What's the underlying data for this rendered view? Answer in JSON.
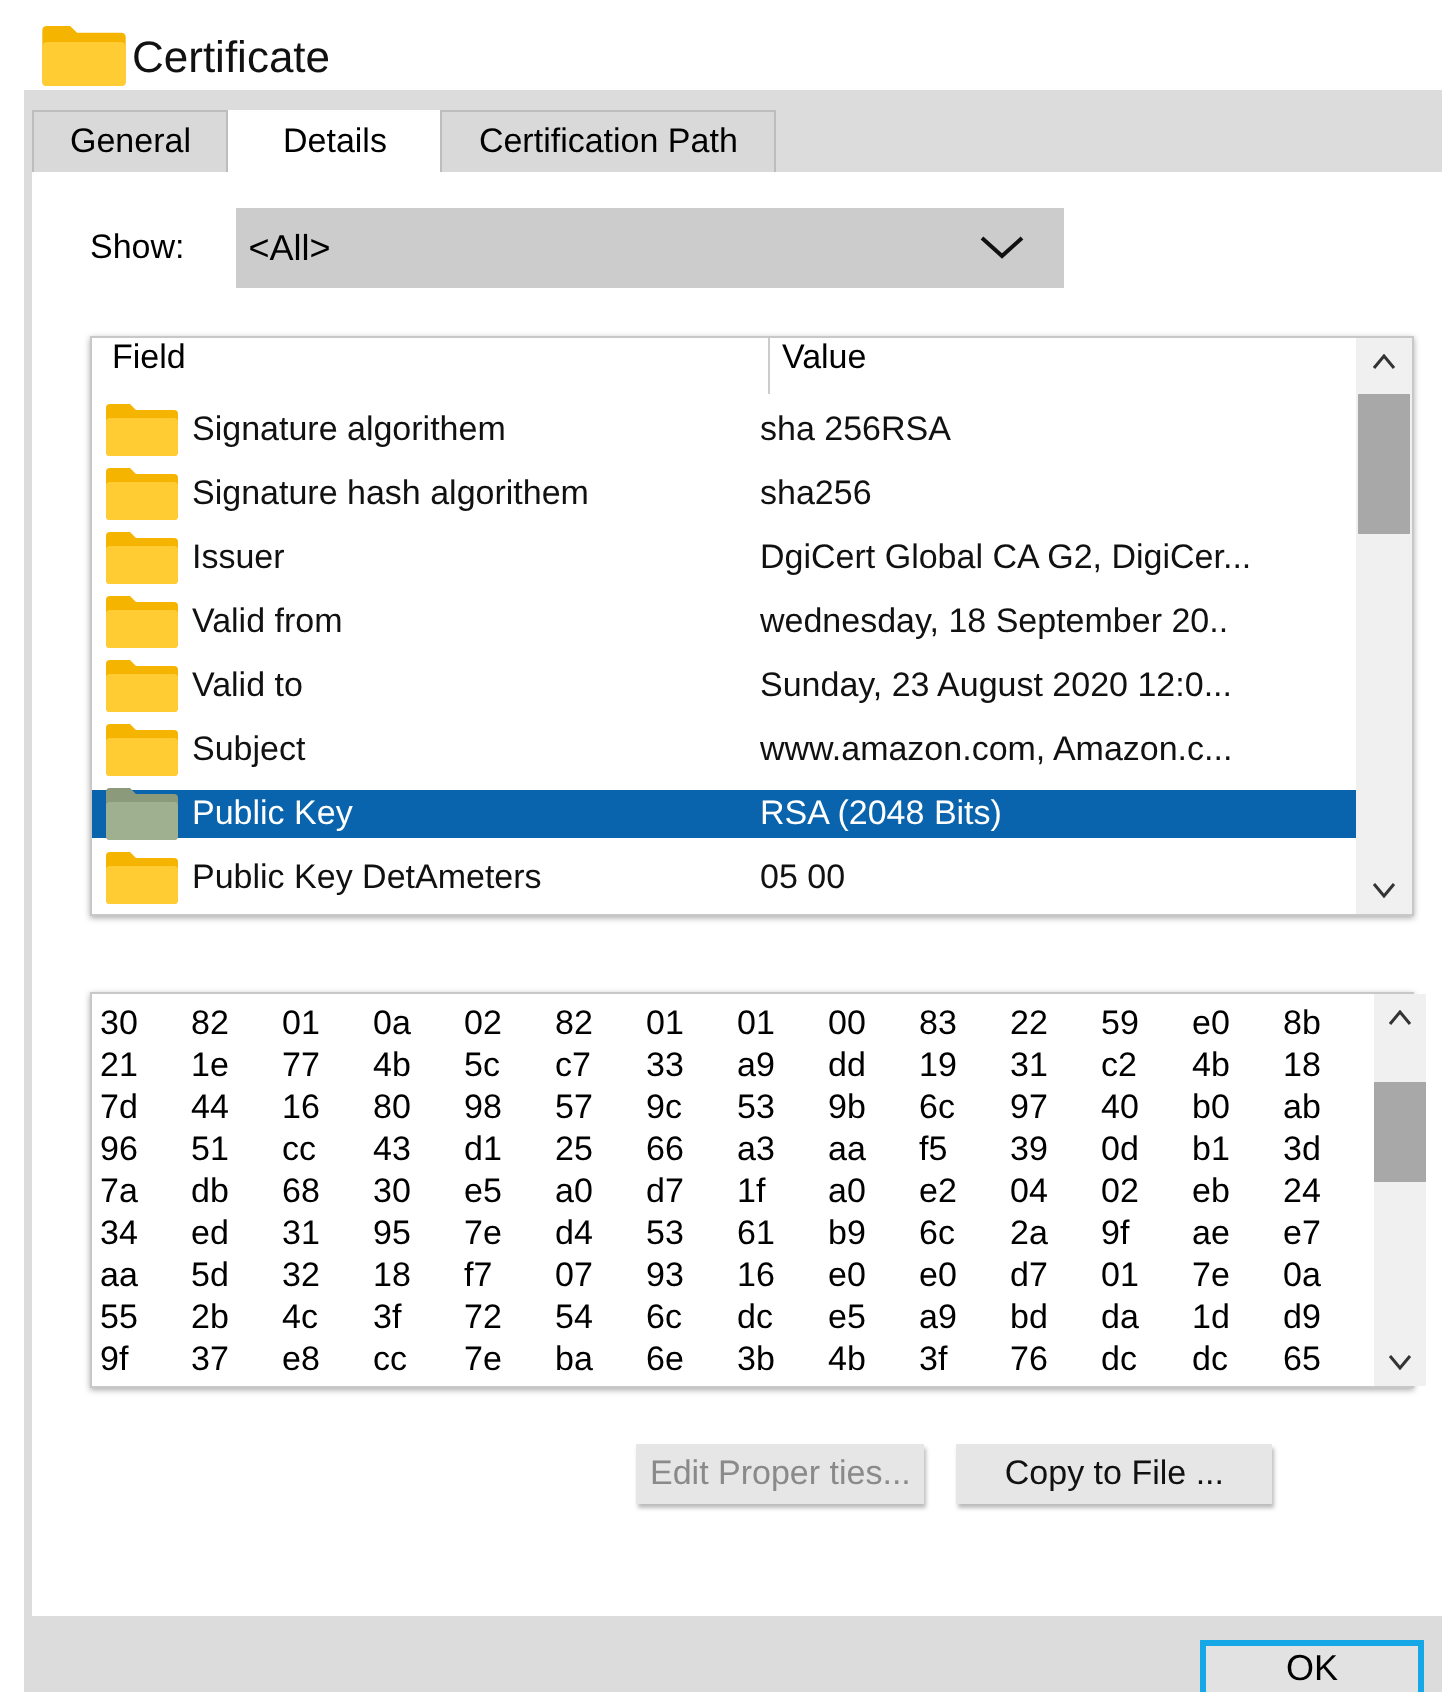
{
  "window": {
    "title": "Certificate"
  },
  "tabs": [
    {
      "label": "General",
      "selected": false
    },
    {
      "label": "Details",
      "selected": true
    },
    {
      "label": "Certification Path",
      "selected": false
    }
  ],
  "show": {
    "label": "Show:",
    "value": "<All>"
  },
  "fields": {
    "columns": [
      "Field",
      "Value"
    ],
    "rows": [
      {
        "field": "Signature algorithem",
        "value": "sha 256RSA",
        "selected": false
      },
      {
        "field": "Signature hash algorithem",
        "value": "sha256",
        "selected": false
      },
      {
        "field": "Issuer",
        "value": "DgiCert Global CA G2, DigiCer...",
        "selected": false
      },
      {
        "field": "Valid from",
        "value": "wednesday, 18 September 20..",
        "selected": false
      },
      {
        "field": "Valid to",
        "value": "Sunday, 23 August 2020 12:0...",
        "selected": false
      },
      {
        "field": "Subject",
        "value": "www.amazon.com, Amazon.c...",
        "selected": false
      },
      {
        "field": "Public Key",
        "value": "RSA (2048 Bits)",
        "selected": true
      },
      {
        "field": "Public Key DetAmeters",
        "value": "05 00",
        "selected": false
      }
    ]
  },
  "hex": [
    [
      "30",
      "82",
      "01",
      "0a",
      "02",
      "82",
      "01",
      "01",
      "00",
      "83",
      "22",
      "59",
      "e0",
      "8b"
    ],
    [
      "21",
      "1e",
      "77",
      "4b",
      "5c",
      "c7",
      "33",
      "a9",
      "dd",
      "19",
      "31",
      "c2",
      "4b",
      "18"
    ],
    [
      "7d",
      "44",
      "16",
      "80",
      "98",
      "57",
      "9c",
      "53",
      "9b",
      "6c",
      "97",
      "40",
      "b0",
      "ab"
    ],
    [
      "96",
      "51",
      "cc",
      "43",
      "d1",
      "25",
      "66",
      "a3",
      "aa",
      "f5",
      "39",
      "0d",
      "b1",
      "3d"
    ],
    [
      "7a",
      "db",
      "68",
      "30",
      "e5",
      "a0",
      "d7",
      "1f",
      "a0",
      "e2",
      "04",
      "02",
      "eb",
      "24"
    ],
    [
      "34",
      "ed",
      "31",
      "95",
      "7e",
      "d4",
      "53",
      "61",
      "b9",
      "6c",
      "2a",
      "9f",
      "ae",
      "e7"
    ],
    [
      "aa",
      "5d",
      "32",
      "18",
      "f7",
      "07",
      "93",
      "16",
      "e0",
      "e0",
      "d7",
      "01",
      "7e",
      "0a"
    ],
    [
      "55",
      "2b",
      "4c",
      "3f",
      "72",
      "54",
      "6c",
      "dc",
      "e5",
      "a9",
      "bd",
      "da",
      "1d",
      "d9"
    ],
    [
      "9f",
      "37",
      "e8",
      "cc",
      "7e",
      "ba",
      "6e",
      "3b",
      "4b",
      "3f",
      "76",
      "dc",
      "dc",
      "65"
    ]
  ],
  "buttons": [
    {
      "label": "Edit Proper ties...",
      "disabled": true
    },
    {
      "label": "Copy to File ...",
      "disabled": false
    }
  ],
  "ok": {
    "label": "OK"
  }
}
